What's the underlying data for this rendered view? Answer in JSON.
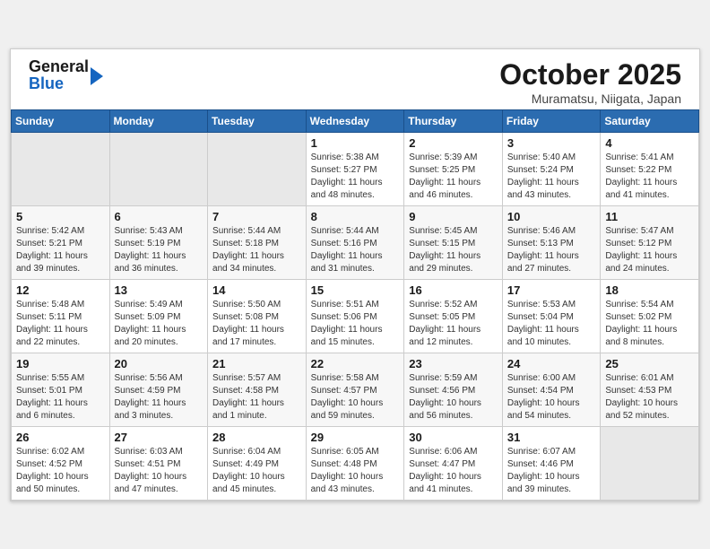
{
  "header": {
    "logo_general": "General",
    "logo_blue": "Blue",
    "title": "October 2025",
    "location": "Muramatsu, Niigata, Japan"
  },
  "weekdays": [
    "Sunday",
    "Monday",
    "Tuesday",
    "Wednesday",
    "Thursday",
    "Friday",
    "Saturday"
  ],
  "weeks": [
    [
      {
        "day": "",
        "sunrise": "",
        "sunset": "",
        "daylight": ""
      },
      {
        "day": "",
        "sunrise": "",
        "sunset": "",
        "daylight": ""
      },
      {
        "day": "",
        "sunrise": "",
        "sunset": "",
        "daylight": ""
      },
      {
        "day": "1",
        "sunrise": "Sunrise: 5:38 AM",
        "sunset": "Sunset: 5:27 PM",
        "daylight": "Daylight: 11 hours and 48 minutes."
      },
      {
        "day": "2",
        "sunrise": "Sunrise: 5:39 AM",
        "sunset": "Sunset: 5:25 PM",
        "daylight": "Daylight: 11 hours and 46 minutes."
      },
      {
        "day": "3",
        "sunrise": "Sunrise: 5:40 AM",
        "sunset": "Sunset: 5:24 PM",
        "daylight": "Daylight: 11 hours and 43 minutes."
      },
      {
        "day": "4",
        "sunrise": "Sunrise: 5:41 AM",
        "sunset": "Sunset: 5:22 PM",
        "daylight": "Daylight: 11 hours and 41 minutes."
      }
    ],
    [
      {
        "day": "5",
        "sunrise": "Sunrise: 5:42 AM",
        "sunset": "Sunset: 5:21 PM",
        "daylight": "Daylight: 11 hours and 39 minutes."
      },
      {
        "day": "6",
        "sunrise": "Sunrise: 5:43 AM",
        "sunset": "Sunset: 5:19 PM",
        "daylight": "Daylight: 11 hours and 36 minutes."
      },
      {
        "day": "7",
        "sunrise": "Sunrise: 5:44 AM",
        "sunset": "Sunset: 5:18 PM",
        "daylight": "Daylight: 11 hours and 34 minutes."
      },
      {
        "day": "8",
        "sunrise": "Sunrise: 5:44 AM",
        "sunset": "Sunset: 5:16 PM",
        "daylight": "Daylight: 11 hours and 31 minutes."
      },
      {
        "day": "9",
        "sunrise": "Sunrise: 5:45 AM",
        "sunset": "Sunset: 5:15 PM",
        "daylight": "Daylight: 11 hours and 29 minutes."
      },
      {
        "day": "10",
        "sunrise": "Sunrise: 5:46 AM",
        "sunset": "Sunset: 5:13 PM",
        "daylight": "Daylight: 11 hours and 27 minutes."
      },
      {
        "day": "11",
        "sunrise": "Sunrise: 5:47 AM",
        "sunset": "Sunset: 5:12 PM",
        "daylight": "Daylight: 11 hours and 24 minutes."
      }
    ],
    [
      {
        "day": "12",
        "sunrise": "Sunrise: 5:48 AM",
        "sunset": "Sunset: 5:11 PM",
        "daylight": "Daylight: 11 hours and 22 minutes."
      },
      {
        "day": "13",
        "sunrise": "Sunrise: 5:49 AM",
        "sunset": "Sunset: 5:09 PM",
        "daylight": "Daylight: 11 hours and 20 minutes."
      },
      {
        "day": "14",
        "sunrise": "Sunrise: 5:50 AM",
        "sunset": "Sunset: 5:08 PM",
        "daylight": "Daylight: 11 hours and 17 minutes."
      },
      {
        "day": "15",
        "sunrise": "Sunrise: 5:51 AM",
        "sunset": "Sunset: 5:06 PM",
        "daylight": "Daylight: 11 hours and 15 minutes."
      },
      {
        "day": "16",
        "sunrise": "Sunrise: 5:52 AM",
        "sunset": "Sunset: 5:05 PM",
        "daylight": "Daylight: 11 hours and 12 minutes."
      },
      {
        "day": "17",
        "sunrise": "Sunrise: 5:53 AM",
        "sunset": "Sunset: 5:04 PM",
        "daylight": "Daylight: 11 hours and 10 minutes."
      },
      {
        "day": "18",
        "sunrise": "Sunrise: 5:54 AM",
        "sunset": "Sunset: 5:02 PM",
        "daylight": "Daylight: 11 hours and 8 minutes."
      }
    ],
    [
      {
        "day": "19",
        "sunrise": "Sunrise: 5:55 AM",
        "sunset": "Sunset: 5:01 PM",
        "daylight": "Daylight: 11 hours and 6 minutes."
      },
      {
        "day": "20",
        "sunrise": "Sunrise: 5:56 AM",
        "sunset": "Sunset: 4:59 PM",
        "daylight": "Daylight: 11 hours and 3 minutes."
      },
      {
        "day": "21",
        "sunrise": "Sunrise: 5:57 AM",
        "sunset": "Sunset: 4:58 PM",
        "daylight": "Daylight: 11 hours and 1 minute."
      },
      {
        "day": "22",
        "sunrise": "Sunrise: 5:58 AM",
        "sunset": "Sunset: 4:57 PM",
        "daylight": "Daylight: 10 hours and 59 minutes."
      },
      {
        "day": "23",
        "sunrise": "Sunrise: 5:59 AM",
        "sunset": "Sunset: 4:56 PM",
        "daylight": "Daylight: 10 hours and 56 minutes."
      },
      {
        "day": "24",
        "sunrise": "Sunrise: 6:00 AM",
        "sunset": "Sunset: 4:54 PM",
        "daylight": "Daylight: 10 hours and 54 minutes."
      },
      {
        "day": "25",
        "sunrise": "Sunrise: 6:01 AM",
        "sunset": "Sunset: 4:53 PM",
        "daylight": "Daylight: 10 hours and 52 minutes."
      }
    ],
    [
      {
        "day": "26",
        "sunrise": "Sunrise: 6:02 AM",
        "sunset": "Sunset: 4:52 PM",
        "daylight": "Daylight: 10 hours and 50 minutes."
      },
      {
        "day": "27",
        "sunrise": "Sunrise: 6:03 AM",
        "sunset": "Sunset: 4:51 PM",
        "daylight": "Daylight: 10 hours and 47 minutes."
      },
      {
        "day": "28",
        "sunrise": "Sunrise: 6:04 AM",
        "sunset": "Sunset: 4:49 PM",
        "daylight": "Daylight: 10 hours and 45 minutes."
      },
      {
        "day": "29",
        "sunrise": "Sunrise: 6:05 AM",
        "sunset": "Sunset: 4:48 PM",
        "daylight": "Daylight: 10 hours and 43 minutes."
      },
      {
        "day": "30",
        "sunrise": "Sunrise: 6:06 AM",
        "sunset": "Sunset: 4:47 PM",
        "daylight": "Daylight: 10 hours and 41 minutes."
      },
      {
        "day": "31",
        "sunrise": "Sunrise: 6:07 AM",
        "sunset": "Sunset: 4:46 PM",
        "daylight": "Daylight: 10 hours and 39 minutes."
      },
      {
        "day": "",
        "sunrise": "",
        "sunset": "",
        "daylight": ""
      }
    ]
  ]
}
